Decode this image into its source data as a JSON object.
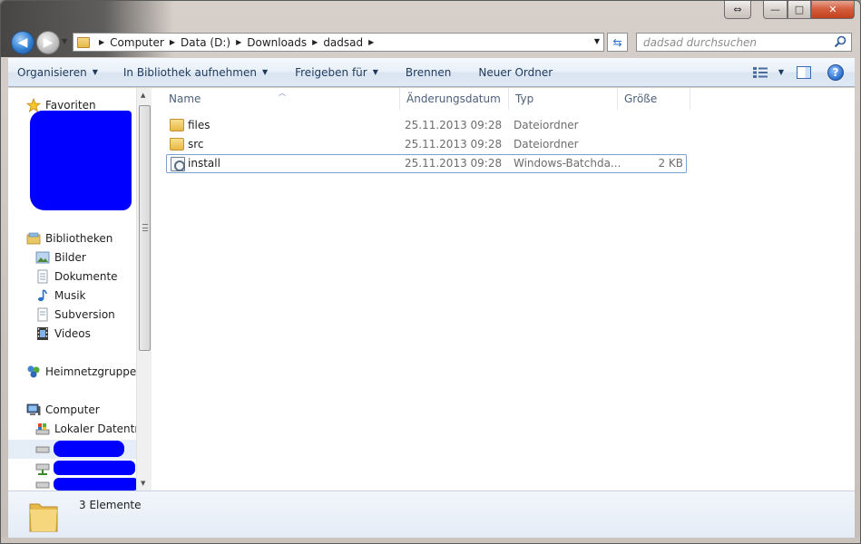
{
  "window": {
    "caption_buttons": {
      "minimize": "—",
      "maximize": "□",
      "close": "✕",
      "resize_extra": "⇔"
    }
  },
  "address": {
    "crumbs": [
      "Computer",
      "Data (D:)",
      "Downloads",
      "dadsad"
    ]
  },
  "search": {
    "placeholder": "dadsad durchsuchen"
  },
  "toolbar": {
    "items": [
      {
        "label": "Organisieren",
        "dropdown": true
      },
      {
        "label": "In Bibliothek aufnehmen",
        "dropdown": true
      },
      {
        "label": "Freigeben für",
        "dropdown": true
      },
      {
        "label": "Brennen",
        "dropdown": false
      },
      {
        "label": "Neuer Ordner",
        "dropdown": false
      }
    ],
    "help": "?"
  },
  "nav": {
    "favorites": "Favoriten",
    "libraries": "Bibliotheken",
    "library_items": [
      "Bilder",
      "Dokumente",
      "Musik",
      "Subversion",
      "Videos"
    ],
    "homegroup": "Heimnetzgruppe",
    "computer": "Computer",
    "local_disk": "Lokaler Datenträger"
  },
  "columns": {
    "name": "Name",
    "modified": "Änderungsdatum",
    "type": "Typ",
    "size": "Größe"
  },
  "files": [
    {
      "name": "files",
      "modified": "25.11.2013 09:28",
      "type": "Dateiordner",
      "size": "",
      "icon": "folder-icon"
    },
    {
      "name": "src",
      "modified": "25.11.2013 09:28",
      "type": "Dateiordner",
      "size": "",
      "icon": "folder-icon"
    },
    {
      "name": "install",
      "modified": "25.11.2013 09:28",
      "type": "Windows-Batchda...",
      "size": "2 KB",
      "icon": "batch-file-icon"
    }
  ],
  "details": {
    "count": "3 Elemente"
  },
  "colors": {
    "redaction": "#0000ff",
    "command_text": "#1e395b",
    "header_text": "#4c607a"
  }
}
